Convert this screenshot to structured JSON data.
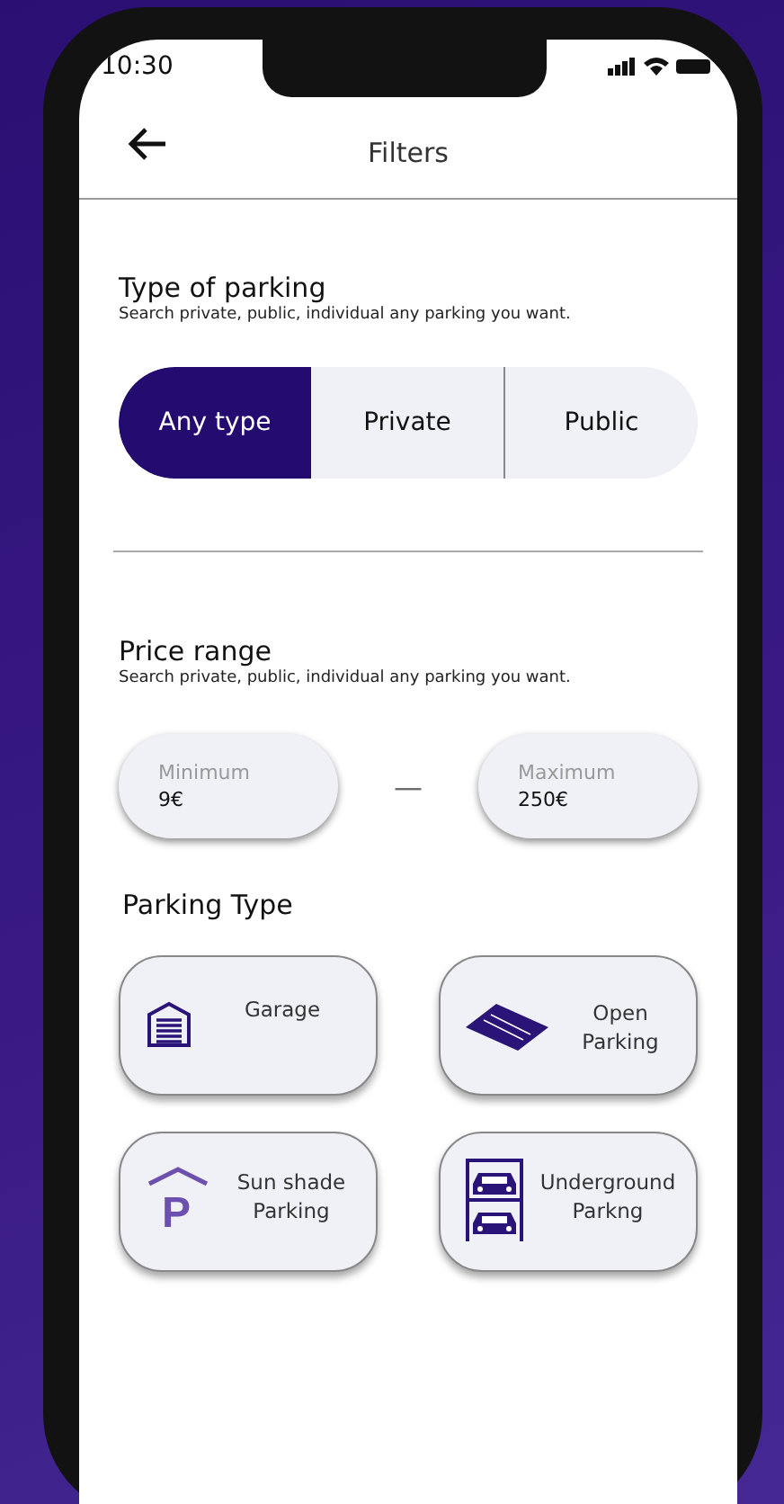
{
  "status_bar": {
    "time": "10:30"
  },
  "header": {
    "title": "Filters"
  },
  "type_of_parking": {
    "title": "Type of parking",
    "subtitle": "Search private, public, individual any parking you want.",
    "options": [
      {
        "label": "Any type",
        "selected": true
      },
      {
        "label": "Private",
        "selected": false
      },
      {
        "label": "Public",
        "selected": false
      }
    ]
  },
  "price_range": {
    "title": "Price range",
    "subtitle": "Search private, public, individual any parking you want.",
    "separator": "—",
    "fields": [
      {
        "placeholder": "Minimum",
        "value": "9€"
      },
      {
        "placeholder": "Maximum",
        "value": "250€"
      }
    ]
  },
  "parking_type": {
    "title": "Parking Type",
    "cards": [
      {
        "kind": "garage",
        "label": "Garage"
      },
      {
        "kind": "open",
        "label": "Open\nParking"
      },
      {
        "kind": "sunshade",
        "icon_glyph": "P",
        "label": "Sun shade\nParking"
      },
      {
        "kind": "underground",
        "label": "Underground\nParkng"
      }
    ]
  }
}
